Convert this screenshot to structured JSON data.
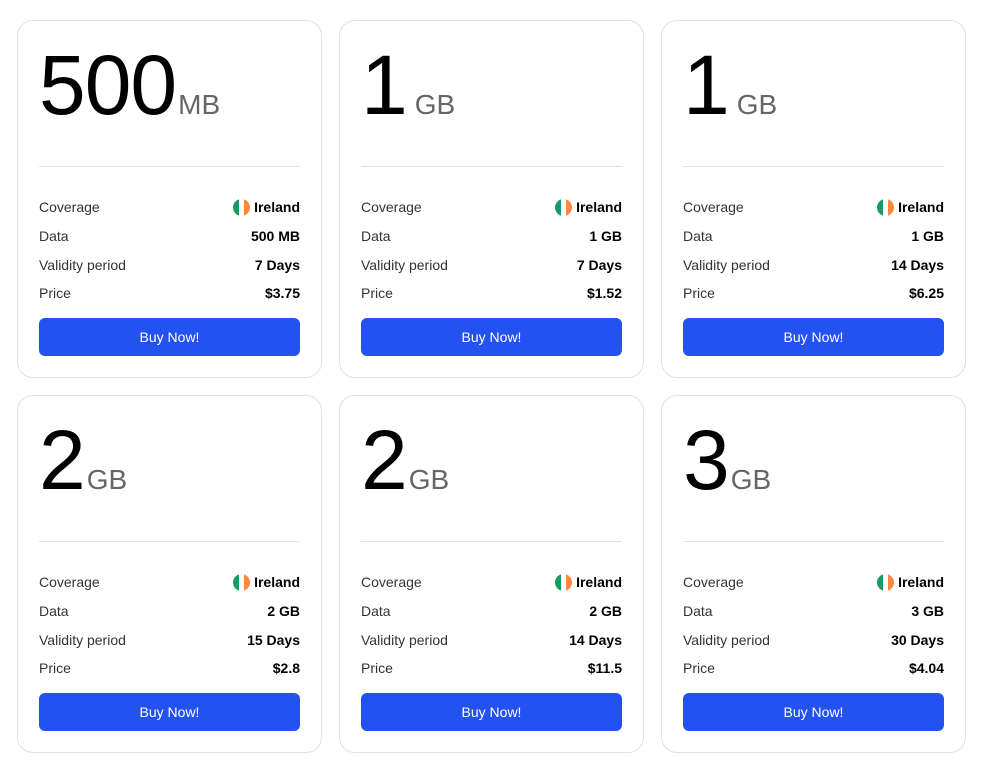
{
  "labels": {
    "coverage": "Coverage",
    "data": "Data",
    "validity": "Validity period",
    "price": "Price",
    "buy": "Buy Now!"
  },
  "flag_colors": [
    "#169b62",
    "#ffffff",
    "#ff883e"
  ],
  "accent_color": "#2352f1",
  "plans": [
    {
      "amount": "500",
      "unit": "MB",
      "coverage": "Ireland",
      "data": "500 MB",
      "validity": "7 Days",
      "price": "$3.75"
    },
    {
      "amount": "1",
      "unit": "GB",
      "coverage": "Ireland",
      "data": "1 GB",
      "validity": "7 Days",
      "price": "$1.52"
    },
    {
      "amount": "1",
      "unit": "GB",
      "coverage": "Ireland",
      "data": "1 GB",
      "validity": "14 Days",
      "price": "$6.25"
    },
    {
      "amount": "2",
      "unit": "GB",
      "coverage": "Ireland",
      "data": "2 GB",
      "validity": "15 Days",
      "price": "$2.8"
    },
    {
      "amount": "2",
      "unit": "GB",
      "coverage": "Ireland",
      "data": "2 GB",
      "validity": "14 Days",
      "price": "$11.5"
    },
    {
      "amount": "3",
      "unit": "GB",
      "coverage": "Ireland",
      "data": "3 GB",
      "validity": "30 Days",
      "price": "$4.04"
    }
  ]
}
